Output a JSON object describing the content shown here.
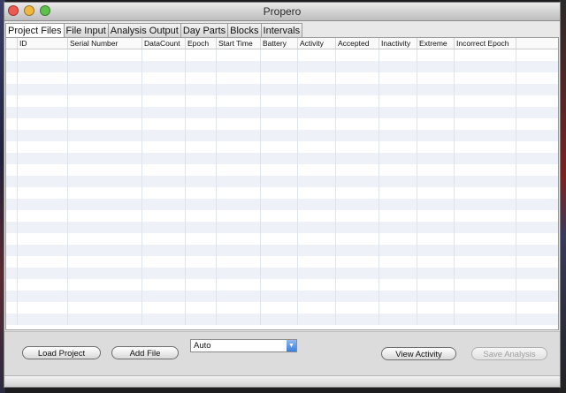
{
  "window": {
    "title": "Propero",
    "lights": {
      "close": "#ec5a52",
      "minimize": "#f0b73e",
      "zoom": "#5fc04b"
    }
  },
  "tabs": [
    {
      "label": "Project Files",
      "active": true
    },
    {
      "label": "File Input",
      "active": false
    },
    {
      "label": "Analysis Output",
      "active": false
    },
    {
      "label": "Day Parts",
      "active": false
    },
    {
      "label": "Blocks",
      "active": false
    },
    {
      "label": "Intervals",
      "active": false
    }
  ],
  "table": {
    "columns": [
      "",
      "ID",
      "Serial Number",
      "DataCount",
      "Epoch",
      "Start Time",
      "Battery",
      "Activity",
      "Accepted",
      "Inactivity",
      "Extreme",
      "Incorrect Epoch",
      ""
    ],
    "rows": []
  },
  "controls": {
    "load_project_label": "Load Project",
    "add_file_label": "Add File",
    "mode_select_value": "Auto",
    "view_activity_label": "View Activity",
    "save_analysis_label": "Save Analysis"
  }
}
